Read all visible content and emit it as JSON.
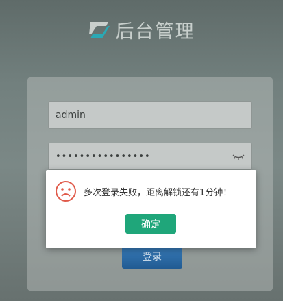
{
  "brand": {
    "title": "后台管理",
    "logo_letter": "Z"
  },
  "login": {
    "username_value": "admin",
    "password_masked": "••••••••••••••••",
    "submit_label": "登录"
  },
  "dialog": {
    "message": "多次登录失败，距离解锁还有1分钟！",
    "confirm_label": "确定",
    "icon": "sad-face-icon",
    "accent_color": "#1fa67a",
    "icon_color": "#e05a4a"
  }
}
